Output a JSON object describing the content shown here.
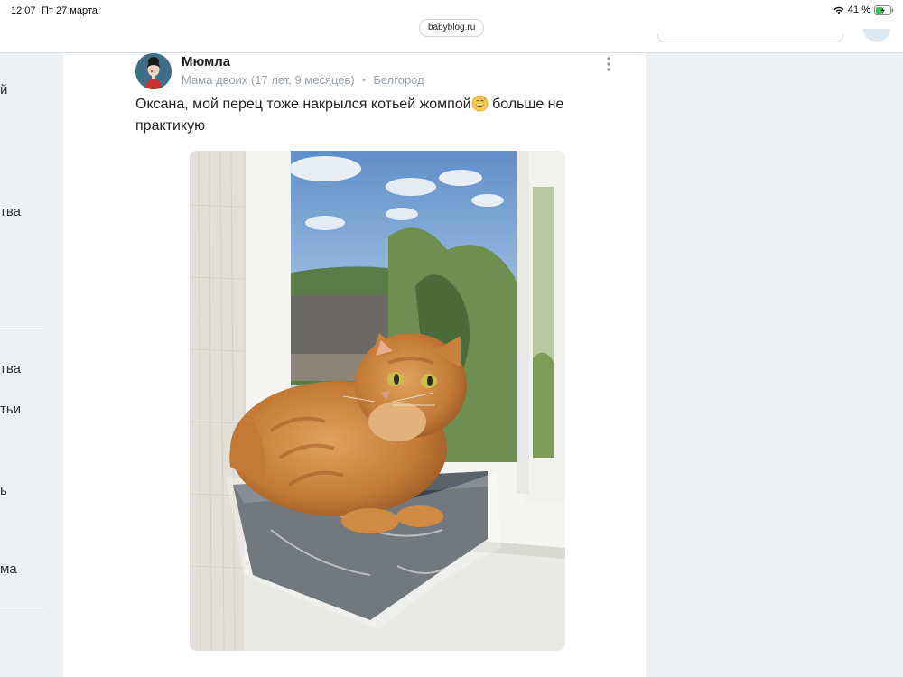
{
  "status_bar": {
    "time": "12:07",
    "date": "Пт 27 марта",
    "battery": "41 %"
  },
  "browser": {
    "url": "babyblog.ru"
  },
  "sidebar": {
    "items": [
      {
        "label": "й"
      },
      {
        "label": "тва"
      },
      {
        "label": "тва"
      },
      {
        "label": "тьи"
      },
      {
        "label": "ь"
      },
      {
        "label": "ма"
      }
    ]
  },
  "post": {
    "author": {
      "name": "Мюмла",
      "meta": "Мама двоих (17 лет, 9 месяцев)",
      "location": "Белгород"
    },
    "text": {
      "mention": "Оксана",
      "body": ", мой перец тоже накрылся котьей жомпой",
      "tail": " больше не практикую"
    }
  },
  "icons": {
    "more": "more-vertical-icon",
    "wifi": "wifi-icon",
    "battery": "battery-charging-icon",
    "emoji": "grinning-sweat-emoji"
  },
  "colors": {
    "accent": "#3f6f86",
    "meta_text": "#9aa3ab",
    "background": "#eef1f4"
  }
}
